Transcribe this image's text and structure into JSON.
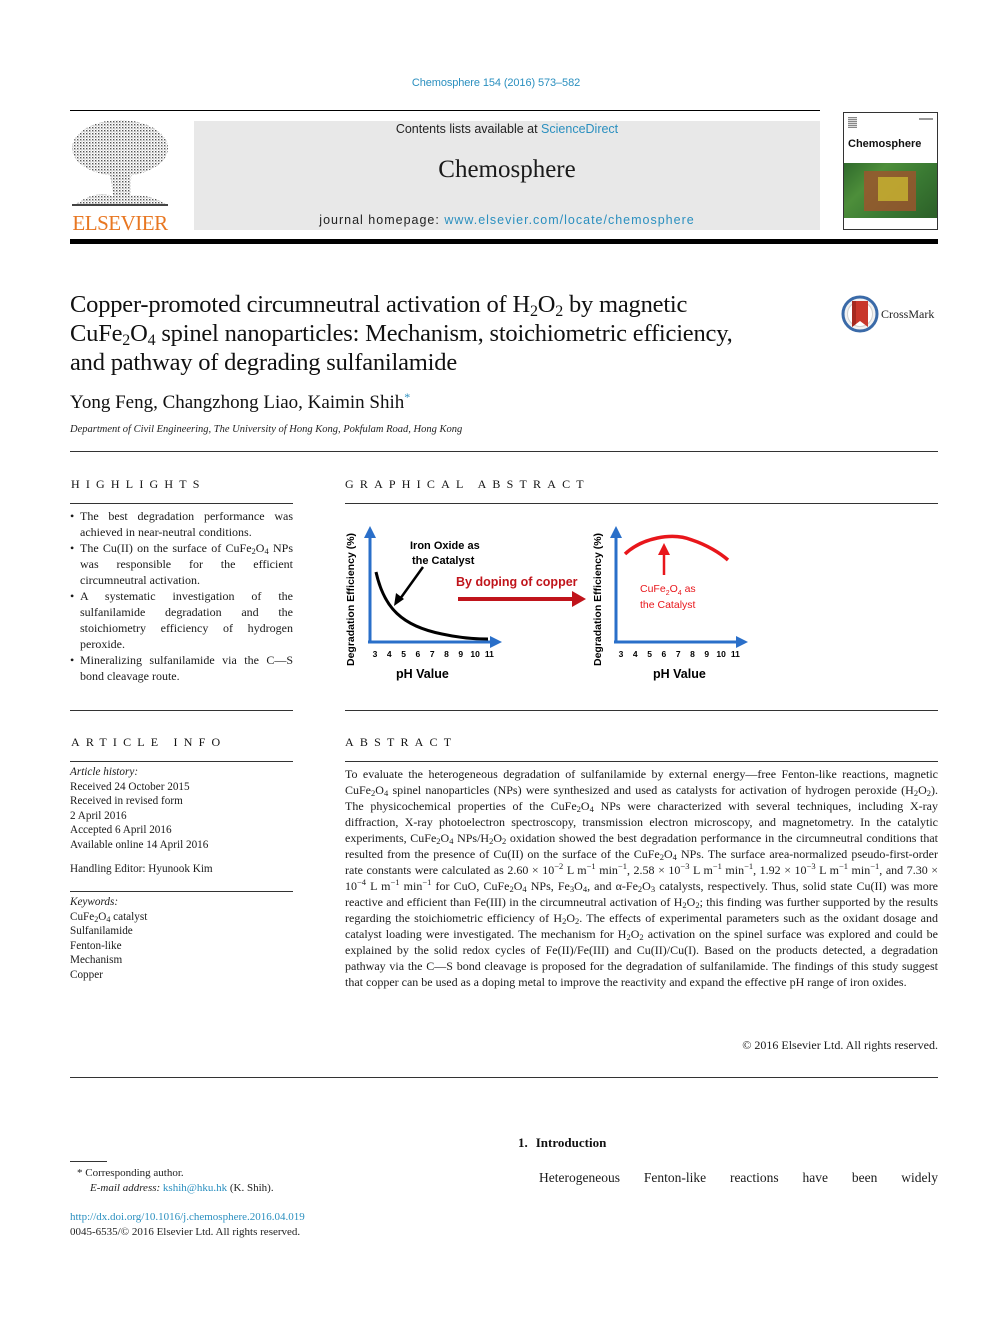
{
  "header": {
    "citation": "Chemosphere 154 (2016) 573–582",
    "contents_prefix": "Contents lists available at ",
    "contents_link": "ScienceDirect",
    "journal_name": "Chemosphere",
    "homepage_prefix": "journal homepage: ",
    "homepage_link": "www.elsevier.com/locate/chemosphere",
    "publisher_logo": "ELSEVIER",
    "cover_title": "Chemosphere",
    "publisher_color": "#e87722",
    "link_color": "#2a8fbf"
  },
  "article": {
    "title_parts": [
      "Copper-promoted circumneutral activation of H",
      "2",
      "O",
      "2",
      " by magnetic",
      "CuFe",
      "2",
      "O",
      "4",
      " spinel nanoparticles: Mechanism, stoichiometric efficiency,",
      "and pathway of degrading sulfanilamide"
    ],
    "authors": "Yong Feng, Changzhong Liao, Kaimin Shih",
    "corresponding_mark": "*",
    "affiliation": "Department of Civil Engineering, The University of Hong Kong, Pokfulam Road, Hong Kong",
    "crossmark_label": "CrossMark"
  },
  "highlights": {
    "heading": "HIGHLIGHTS",
    "items": [
      "The best degradation performance was achieved in near-neutral conditions.",
      "The Cu(II) on the surface of CuFe2O4 NPs was responsible for the efficient circumneutral activation.",
      "A systematic investigation of the sulfanilamide degradation and the stoichiometry efficiency of hydrogen peroxide.",
      "Mineralizing sulfanilamide via the C—S bond cleavage route."
    ]
  },
  "graphical_abstract": {
    "heading": "GRAPHICAL ABSTRACT",
    "left_plot": {
      "ylabel": "Degradation Efficiency (%)",
      "xlabel": "pH Value",
      "xticks": [
        "3",
        "4",
        "5",
        "6",
        "7",
        "8",
        "9",
        "10",
        "11"
      ],
      "annotation_line1": "Iron Oxide as",
      "annotation_line2": "the Catalyst"
    },
    "arrow_label": "By doping of copper",
    "right_plot": {
      "ylabel": "Degradation Efficiency (%)",
      "xlabel": "pH Value",
      "xticks": [
        "3",
        "4",
        "5",
        "6",
        "7",
        "8",
        "9",
        "10",
        "11"
      ],
      "annotation_line1_a": "CuFe",
      "annotation_line1_sub1": "2",
      "annotation_line1_b": "O",
      "annotation_line1_sub2": "4",
      "annotation_line1_c": " as",
      "annotation_line2": "the Catalyst"
    },
    "colors": {
      "axis": "#2a6fc9",
      "red": "#e8161b",
      "dark_red": "#c0141b",
      "black": "#000000"
    }
  },
  "article_info": {
    "heading": "ARTICLE INFO",
    "history_label": "Article history:",
    "history": [
      "Received 24 October 2015",
      "Received in revised form",
      "2 April 2016",
      "Accepted 6 April 2016",
      "Available online 14 April 2016"
    ],
    "handling_editor": "Handling Editor: Hyunook Kim",
    "keywords_label": "Keywords:",
    "keywords": [
      "CuFe2O4 catalyst",
      "Sulfanilamide",
      "Fenton-like",
      "Mechanism",
      "Copper"
    ]
  },
  "abstract": {
    "heading": "ABSTRACT",
    "copyright": "© 2016 Elsevier Ltd. All rights reserved."
  },
  "introduction": {
    "number": "1.",
    "heading": "Introduction",
    "first_line": "Heterogeneous Fenton-like reactions have been widely"
  },
  "footnotes": {
    "corresponding": "* Corresponding author.",
    "email_label": "E-mail address: ",
    "email": "kshih@hku.hk",
    "email_suffix": " (K. Shih).",
    "doi": "http://dx.doi.org/10.1016/j.chemosphere.2016.04.019",
    "issn": "0045-6535/© 2016 Elsevier Ltd. All rights reserved."
  }
}
